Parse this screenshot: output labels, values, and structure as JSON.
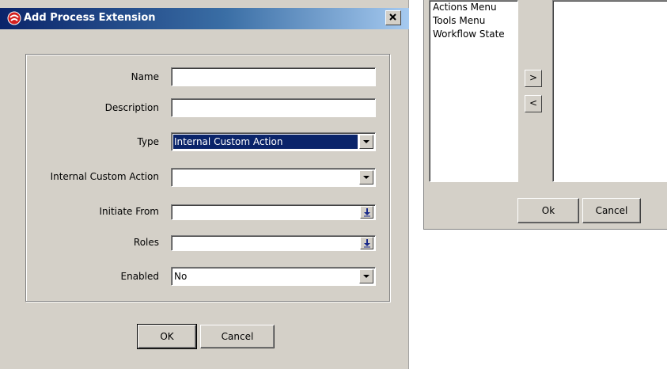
{
  "dialog": {
    "title": "Add Process Extension",
    "close_label": "X",
    "fields": [
      {
        "label": "Name",
        "value": "",
        "kind": "text"
      },
      {
        "label": "Description",
        "value": "",
        "kind": "text"
      },
      {
        "label": "Type",
        "value": "Internal Custom Action",
        "kind": "dropdown"
      },
      {
        "label": "Internal Custom Action",
        "value": "",
        "kind": "dropdown"
      },
      {
        "label": "Initiate From",
        "value": "",
        "kind": "multiselect"
      },
      {
        "label": "Roles",
        "value": "",
        "kind": "multiselect"
      },
      {
        "label": "Enabled",
        "value": "No",
        "kind": "dropdown"
      }
    ],
    "ok_label": "OK",
    "cancel_label": "Cancel"
  },
  "selector_panel": {
    "available_items": [
      "Actions Menu",
      "Tools Menu",
      "Workflow State"
    ],
    "selected_items": [],
    "add_label": ">",
    "remove_label": "<",
    "ok_label": "Ok",
    "cancel_label": "Cancel"
  },
  "colors": {
    "title_start": "#0a246a",
    "title_end": "#a6caf0",
    "dialog_bg": "#d4d0c8",
    "selection": "#0a246a"
  }
}
